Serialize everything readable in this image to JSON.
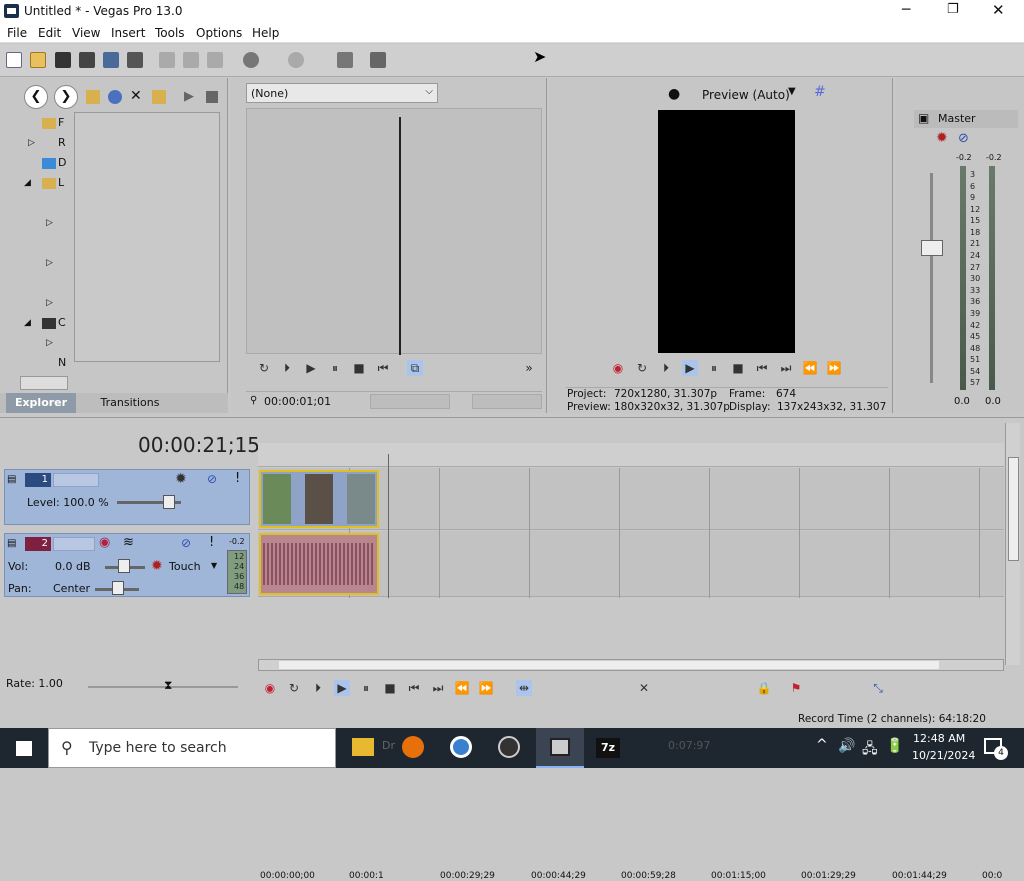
{
  "window": {
    "title": "Untitled * - Vegas Pro 13.0"
  },
  "menu": [
    "File",
    "Edit",
    "View",
    "Insert",
    "Tools",
    "Options",
    "Help"
  ],
  "explorer": {
    "tree_labels": [
      "F",
      "R",
      "D",
      "L",
      "C",
      "N"
    ],
    "tabs": [
      "Explorer",
      "Transitions"
    ]
  },
  "trimmer": {
    "dropdown_value": "(None)",
    "timecode": "00:00:01;01"
  },
  "preview": {
    "mode": "Preview (Auto)",
    "project_label": "Project:",
    "project_value": "720x1280, 31.307p",
    "preview_label": "Preview:",
    "preview_value": "180x320x32, 31.307p",
    "frame_label": "Frame:",
    "frame_value": "674",
    "display_label": "Display:",
    "display_value": "137x243x32, 31.307"
  },
  "mixer": {
    "master_label": "Master",
    "peak_left": "-0.2",
    "peak_right": "-0.2",
    "scale": [
      "3",
      "6",
      "9",
      "12",
      "15",
      "18",
      "21",
      "24",
      "27",
      "30",
      "33",
      "36",
      "39",
      "42",
      "45",
      "48",
      "51",
      "54",
      "57"
    ],
    "value_left": "0.0",
    "value_right": "0.0"
  },
  "timeline": {
    "timecode": "00:00:21;15",
    "ruler": [
      "00:00:00;00",
      "00:00:1",
      "00:00:29;29",
      "00:00:44;29",
      "00:00:59;28",
      "00:01:15;00",
      "00:01:29;29",
      "00:01:44;29",
      "00:0"
    ],
    "video_track": {
      "number": "1",
      "level": "Level: 100.0 %"
    },
    "audio_track": {
      "number": "2",
      "vol_label": "Vol:",
      "vol_value": "0.0 dB",
      "pan_label": "Pan:",
      "pan_value": "Center",
      "automation": "Touch",
      "meter_peak": "-0.2",
      "meter_scale": [
        "12",
        "24",
        "36",
        "48"
      ]
    },
    "rate": "Rate: 1.00",
    "record_time": "Record Time (2 channels): 64:18:20"
  },
  "taskbar": {
    "search_placeholder": "Type here to search",
    "time": "12:48 AM",
    "date": "10/21/2024",
    "notification_count": "4",
    "ghost_text": [
      "Dr",
      "0:07:97"
    ]
  },
  "colors": {
    "accent": "#3a6fb0",
    "video_track": "#9fb6d8",
    "audio_clip": "#b7868f",
    "clip_border": "#e0c020"
  }
}
